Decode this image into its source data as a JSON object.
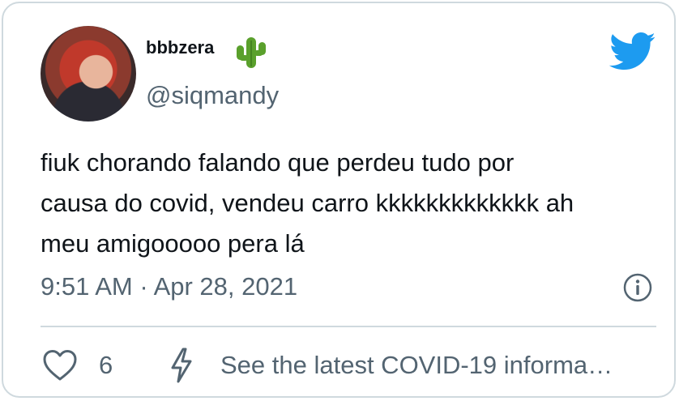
{
  "tweet": {
    "display_name": "bbbzera",
    "name_emoji_icon": "cactus-icon",
    "handle": "@siqmandy",
    "text": "fiuk chorando falando que perdeu tudo por\ncausa do covid, vendeu carro kkkkkkkkkkkkk ah\nmeu amigooooo pera lá",
    "timestamp": "9:51 AM · Apr 28, 2021",
    "like_count": "6",
    "covid_notice": "See the latest COVID-19 informa…"
  },
  "colors": {
    "brand": "#1d9bf0",
    "text_primary": "#0f1419",
    "text_secondary": "#536471",
    "border": "#cfd9de"
  },
  "icons": [
    "avatar",
    "cactus-icon",
    "twitter-bird-icon",
    "info-icon",
    "heart-icon",
    "lightning-bolt-icon"
  ]
}
